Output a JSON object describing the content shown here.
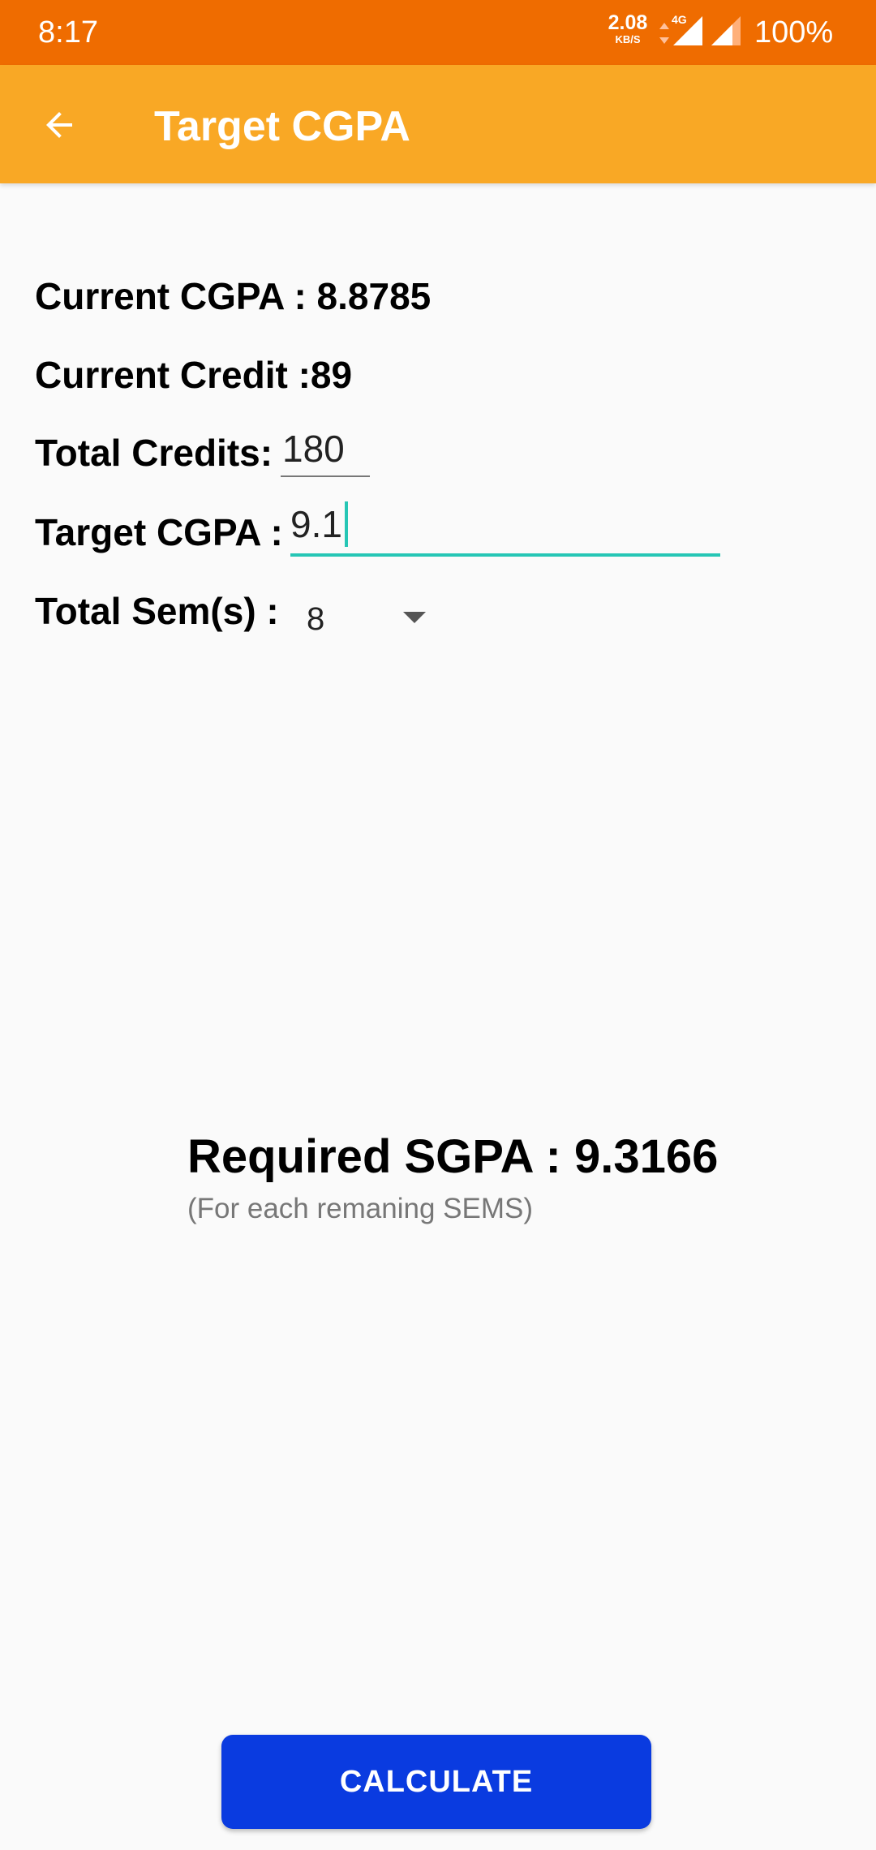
{
  "status_bar": {
    "time": "8:17",
    "net_speed_value": "2.08",
    "net_speed_unit": "KB/S",
    "network_type": "4G",
    "battery": "100%"
  },
  "app_bar": {
    "title": "Target CGPA",
    "back_icon": "arrow-back-icon",
    "background_color": "#f9a825"
  },
  "form": {
    "current_cgpa_label": "Current CGPA : 8.8785",
    "current_credit_label": "Current Credit :89",
    "total_credits_label": "Total Credits:",
    "total_credits_value": "180",
    "target_cgpa_label": "Target CGPA :",
    "target_cgpa_value": "9.1",
    "total_sems_label": "Total Sem(s) :",
    "total_sems_selected": "8"
  },
  "result": {
    "title": "Required SGPA : 9.3166",
    "subtitle": "(For each remaning SEMS)"
  },
  "actions": {
    "calculate_label": "CALCULATE",
    "button_color": "#0a3be0"
  },
  "colors": {
    "status_bar": "#ef6c00",
    "accent": "#26c6b5"
  }
}
